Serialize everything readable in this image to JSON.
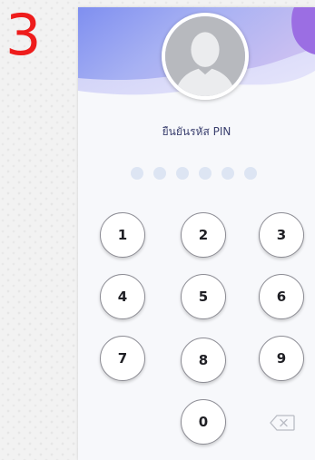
{
  "step_number": "3",
  "colors": {
    "step_number": "#ee1c1c",
    "header_top": "#7f8ff0",
    "header_accent": "#b07ee6",
    "pin_dot": "#dde5f3",
    "prompt_text": "#3a3f6e"
  },
  "pin_screen": {
    "avatar_icon": "default-user-avatar-icon",
    "prompt": "ยืนยันรหัส PIN",
    "pin_length": 6,
    "pin_entered": 0,
    "keys": [
      "1",
      "2",
      "3",
      "4",
      "5",
      "6",
      "7",
      "8",
      "9",
      "0"
    ],
    "backspace_icon": "backspace-icon"
  }
}
